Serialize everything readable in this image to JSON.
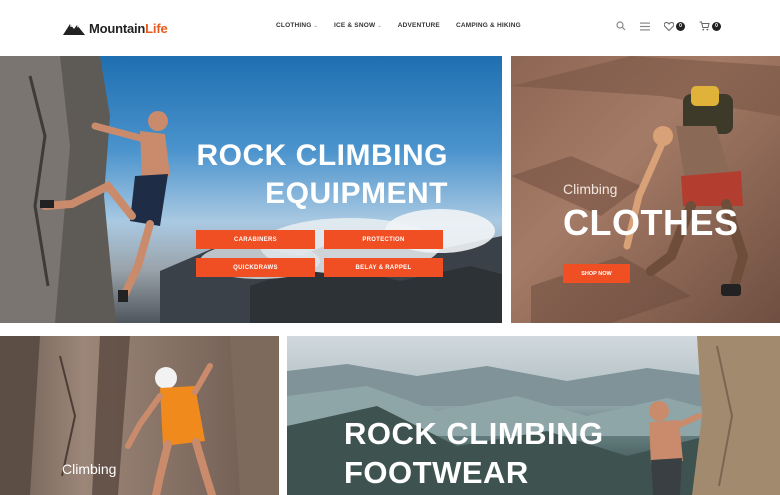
{
  "brand": {
    "name_part1": "Mountain",
    "name_part2": "Life"
  },
  "nav": {
    "items": [
      {
        "label": "CLOTHING",
        "has_dropdown": true
      },
      {
        "label": "ICE & SNOW",
        "has_dropdown": true
      },
      {
        "label": "ADVENTURE",
        "has_dropdown": false
      },
      {
        "label": "CAMPING & HIKING",
        "has_dropdown": false
      }
    ],
    "dropdown_glyph": "⌄"
  },
  "tools": {
    "search_icon": "search-icon",
    "menu_icon": "menu-icon",
    "wishlist_count": "0",
    "cart_count": "0"
  },
  "banners": {
    "equipment": {
      "heading_line1": "ROCK CLIMBING",
      "heading_line2": "EQUIPMENT",
      "buttons": [
        "CARABINERS",
        "PROTECTION",
        "QUICKDRAWS",
        "BELAY & RAPPEL"
      ]
    },
    "clothes": {
      "subtitle": "Climbing",
      "heading": "CLOTHES",
      "button": "SHOP NOW"
    },
    "climbing": {
      "subtitle": "Climbing"
    },
    "footwear": {
      "heading_line1": "ROCK CLIMBING",
      "heading_line2": "FOOTWEAR"
    }
  },
  "colors": {
    "accent": "#f04e23",
    "brand_accent": "#e85a1e",
    "text_dark": "#222222"
  }
}
